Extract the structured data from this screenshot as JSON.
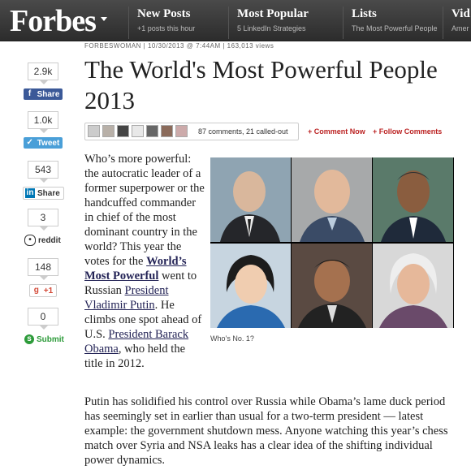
{
  "header": {
    "logo": "Forbes",
    "nav": [
      {
        "title": "New Posts",
        "sub": "+1 posts this hour"
      },
      {
        "title": "Most Popular",
        "sub": "5 LinkedIn Strategies"
      },
      {
        "title": "Lists",
        "sub": "The Most Powerful People"
      },
      {
        "title": "Vid",
        "sub": "Amer"
      }
    ]
  },
  "share": [
    {
      "count": "2.9k",
      "label": "Share",
      "network": "facebook",
      "color": "#3b5998"
    },
    {
      "count": "1.0k",
      "label": "Tweet",
      "network": "twitter",
      "color": "#4a9fd8"
    },
    {
      "count": "543",
      "label": "Share",
      "network": "linkedin",
      "color": "#0077b5"
    },
    {
      "count": "3",
      "label": "reddit",
      "network": "reddit",
      "color": "#333333"
    },
    {
      "count": "148",
      "label": "+1",
      "network": "googleplus",
      "color": "#d34836"
    },
    {
      "count": "0",
      "label": "Submit",
      "network": "stumbleupon",
      "color": "#2d9b3a"
    }
  ],
  "article": {
    "meta": "FORBESWOMAN  |  10/30/2013 @ 7:44AM  |  163,013 views",
    "title": "The World's Most Powerful People 2013",
    "callout": "87 comments, 21 called-out",
    "comment_now": "+ Comment Now",
    "follow_comments": "+ Follow Comments",
    "p1_a": "Who’s more powerful: the autocratic leader of a former superpower or the handcuffed commander in chief of the most dominant country in the world? This year the votes for the ",
    "p1_link1": "World’s Most Powerful",
    "p1_b": " went to Russian ",
    "p1_link2": "President Vladimir Putin",
    "p1_c": ". He climbs one spot ahead of U.S. ",
    "p1_link3": "President Barack Obama",
    "p1_d": ", who held the title in 2012.",
    "caption": "Who’s No. 1?",
    "p2": "Putin has solidified his control over Russia while Obama’s lame duck period has seemingly set in earlier than usual for a two-term president — latest example: the government shutdown mess. Anyone watching this year’s chess match over Syria and NSA leaks has a clear idea of the shifting individual power dynamics."
  },
  "colors": {
    "accent": "#b22222",
    "nav_bg": "#333333",
    "link": "#222255"
  }
}
